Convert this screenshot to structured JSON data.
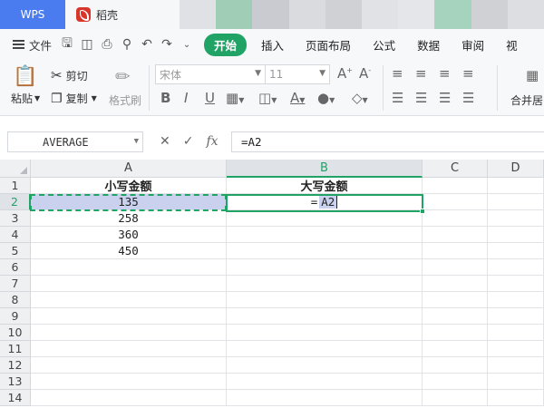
{
  "tabs": {
    "wps": "WPS",
    "doc": "稻壳"
  },
  "menu": {
    "file": "文件",
    "tabs": [
      "开始",
      "插入",
      "页面布局",
      "公式",
      "数据",
      "审阅",
      "视"
    ]
  },
  "ribbon": {
    "paste": "粘贴",
    "cut": "剪切",
    "copy": "复制",
    "format_painter": "格式刷",
    "font_name": "宋体",
    "font_size": "11",
    "merge": "合并居"
  },
  "formula_bar": {
    "name_box": "AVERAGE",
    "fx": "fx",
    "formula": "=A2"
  },
  "sheet": {
    "columns": [
      "A",
      "B",
      "C",
      "D"
    ],
    "rows": [
      "1",
      "2",
      "3",
      "4",
      "5",
      "6",
      "7",
      "8",
      "9",
      "10",
      "11",
      "12",
      "13",
      "14"
    ],
    "cells": {
      "A1": "小写金额",
      "B1": "大写金额",
      "A2": "135",
      "A3": "258",
      "A4": "360",
      "A5": "450"
    },
    "edit": {
      "eq": "=",
      "ref": "A2"
    }
  },
  "colors": {
    "accent": "#21a366",
    "wps_tab": "#4a7cf0",
    "ref_highlight": "#c9d1ef"
  }
}
